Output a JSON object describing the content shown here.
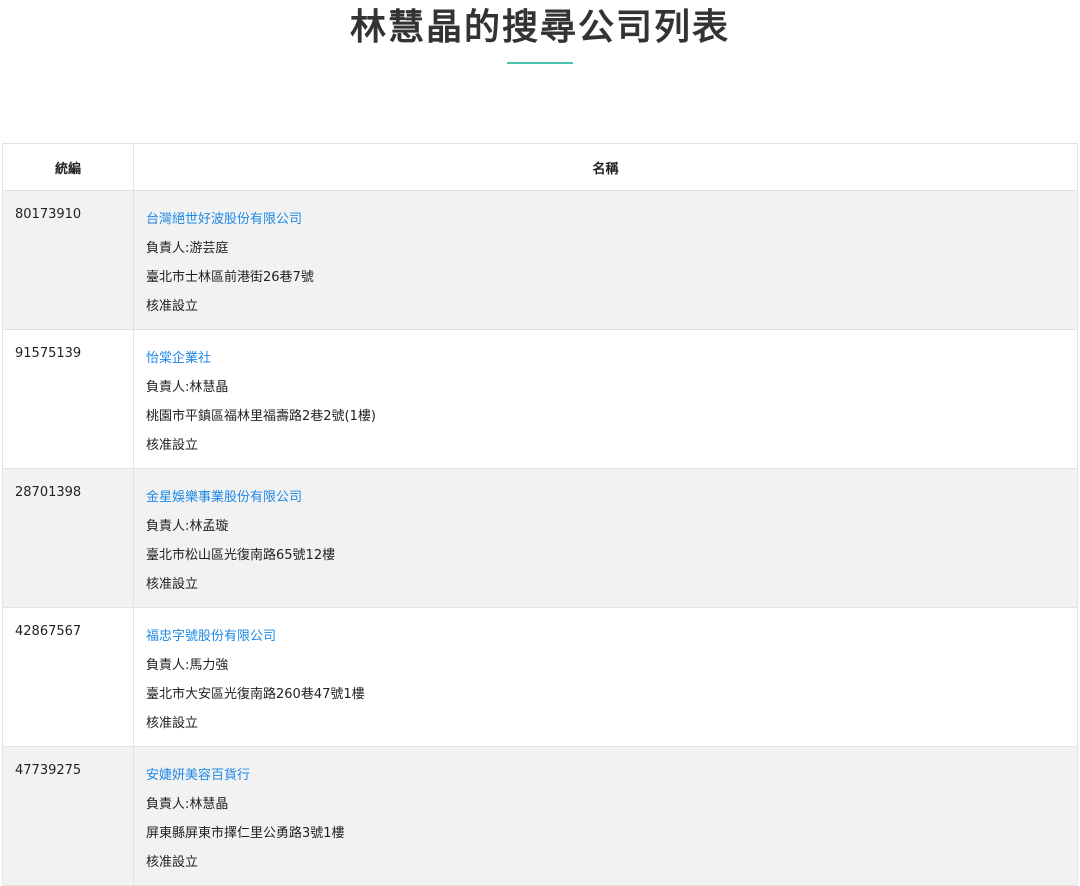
{
  "page": {
    "title": "林慧晶的搜尋公司列表"
  },
  "table": {
    "headers": {
      "tax_id": "統編",
      "name": "名稱"
    },
    "rows": [
      {
        "tax_id": "80173910",
        "company_name": "台灣絕世好波股份有限公司",
        "responsible": "負責人:游芸庭",
        "address": "臺北市士林區前港街26巷7號",
        "status": "核准設立"
      },
      {
        "tax_id": "91575139",
        "company_name": "怡棠企業社",
        "responsible": "負責人:林慧晶",
        "address": "桃園市平鎮區福林里福壽路2巷2號(1樓)",
        "status": "核准設立"
      },
      {
        "tax_id": "28701398",
        "company_name": "金星娛樂事業股份有限公司",
        "responsible": "負責人:林孟璇",
        "address": "臺北市松山區光復南路65號12樓",
        "status": "核准設立"
      },
      {
        "tax_id": "42867567",
        "company_name": "福忠字號股份有限公司",
        "responsible": "負責人:馬力強",
        "address": "臺北市大安區光復南路260巷47號1樓",
        "status": "核准設立"
      },
      {
        "tax_id": "47739275",
        "company_name": "安婕妍美容百貨行",
        "responsible": "負責人:林慧晶",
        "address": "屏東縣屏東市擇仁里公勇路3號1樓",
        "status": "核准設立"
      }
    ]
  },
  "colors": {
    "accent": "#4cc3b1",
    "link": "#1e88e5",
    "row_stripe": "#f2f2f2",
    "border": "#e3e3e3"
  }
}
